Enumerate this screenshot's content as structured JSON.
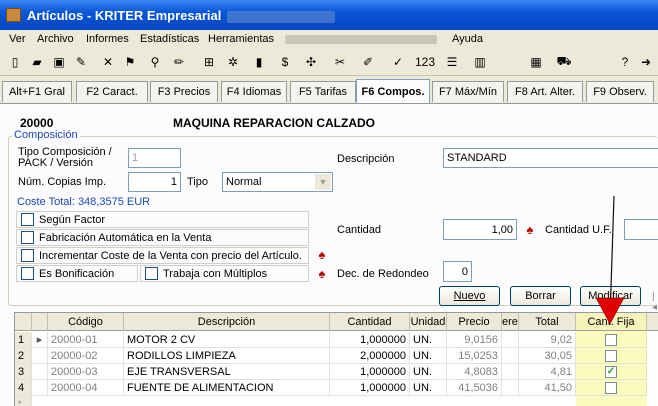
{
  "window": {
    "title": "Artículos - KRITER Empresarial"
  },
  "menu": {
    "items": [
      "Ver",
      "Archivo",
      "Informes",
      "Estadísticas",
      "Herramientas",
      "Ayuda"
    ]
  },
  "tabs": [
    "Alt+F1 Gral",
    "F2 Caract.",
    "F3 Precios",
    "F4 Idiomas",
    "F5 Tarifas",
    "F6 Compos.",
    "F7 Máx/Mín",
    "F8 Art. Alter.",
    "F9 Observ."
  ],
  "active_tab": "F6 Compos.",
  "article": {
    "code": "20000",
    "name": "MAQUINA REPARACION CALZADO"
  },
  "composicion": {
    "group_label": "Composición",
    "tipo_label": "Tipo Composición / PACK / Versión",
    "tipo_value": "1",
    "copias_label": "Núm. Copias Imp.",
    "copias_value": "1",
    "tipo2_label": "Tipo",
    "tipo2_value": "Normal",
    "descripcion_label": "Descripción",
    "descripcion_value": "STANDARD",
    "coste_total": "Coste Total: 348,3575 EUR",
    "cantidad_label": "Cantidad",
    "cantidad_value": "1,00",
    "cantidad_uf_label": "Cantidad U.F.",
    "redondeo_label": "Dec. de Redondeo",
    "redondeo_value": "0",
    "checks": {
      "segun_factor": "Según Factor",
      "fabricacion": "Fabricación Automática en la Venta",
      "incrementar": "Incrementar Coste de la Venta con precio del Artículo.",
      "bonificacion": "Es Bonificación",
      "multiplos": "Trabaja con Múltiplos"
    }
  },
  "buttons": {
    "nuevo": "Nuevo",
    "borrar": "Borrar",
    "modificar": "Modificar"
  },
  "grid": {
    "headers": [
      "Código",
      "Descripción",
      "Cantidad",
      "Unidad",
      "Precio",
      "ere",
      "Total",
      "Cant. Fija"
    ],
    "rows": [
      {
        "n": "1",
        "codigo": "20000-01",
        "descripcion": "MOTOR 2 CV",
        "cantidad": "1,000000",
        "unidad": "UN.",
        "precio": "9,0156",
        "total": "9,02",
        "fija": false
      },
      {
        "n": "2",
        "codigo": "20000-02",
        "descripcion": "RODILLOS LIMPIEZA",
        "cantidad": "2,000000",
        "unidad": "UN.",
        "precio": "15,0253",
        "total": "30,05",
        "fija": false
      },
      {
        "n": "3",
        "codigo": "20000-03",
        "descripcion": "EJE TRANSVERSAL",
        "cantidad": "1,000000",
        "unidad": "UN.",
        "precio": "4,8083",
        "total": "4,81",
        "fija": true
      },
      {
        "n": "4",
        "codigo": "20000-04",
        "descripcion": "FUENTE DE ALIMENTACION",
        "cantidad": "1,000000",
        "unidad": "UN.",
        "precio": "41,5036",
        "total": "41,50",
        "fija": false
      }
    ]
  },
  "colors": {
    "title_bar": "#0a57d8",
    "highlight_column": "#fcfbbe",
    "annotation_arrow": "#e00000",
    "check_green": "#21a121"
  }
}
